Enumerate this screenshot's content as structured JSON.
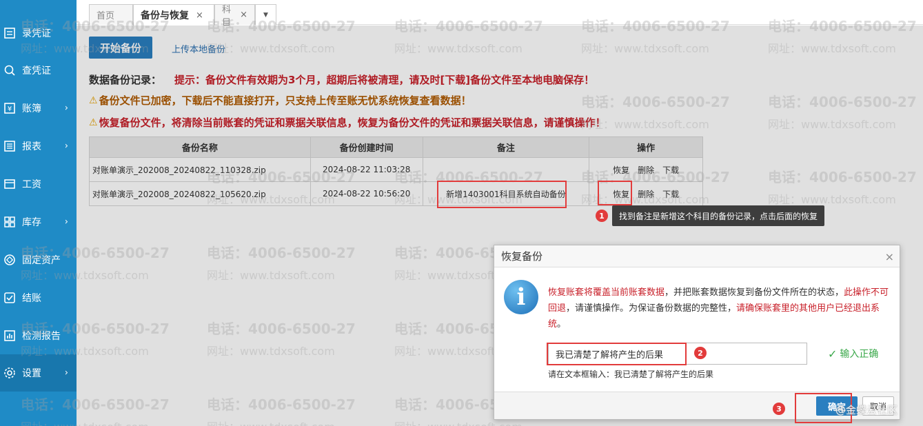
{
  "sidebar": {
    "items": [
      {
        "label": "录凭证",
        "icon": "voucher-icon"
      },
      {
        "label": "查凭证",
        "icon": "search-icon"
      },
      {
        "label": "账簿",
        "icon": "ledger-icon"
      },
      {
        "label": "报表",
        "icon": "report-icon"
      },
      {
        "label": "工资",
        "icon": "salary-icon"
      },
      {
        "label": "库存",
        "icon": "inventory-icon"
      },
      {
        "label": "固定资产",
        "icon": "asset-icon"
      },
      {
        "label": "结账",
        "icon": "checkout-icon"
      },
      {
        "label": "检测报告",
        "icon": "chart-icon"
      },
      {
        "label": "设置",
        "icon": "gear-icon"
      }
    ]
  },
  "tabs": {
    "home": "首页",
    "active": "备份与恢复",
    "subject": "科目",
    "close": "×"
  },
  "content": {
    "start_backup": "开始备份",
    "upload_local": "上传本地备份",
    "records_title": "数据备份记录：",
    "records_tip": "提示：备份文件有效期为3个月，超期后将被清理，请及时[下载]备份文件至本地电脑保存！",
    "warn1": "备份文件已加密，下载后不能直接打开，只支持上传至账无忧系统恢复查看数据！",
    "warn2": "恢复备份文件，将清除当前账套的凭证和票据关联信息，恢复为备份文件的凭证和票据关联信息，请谨慎操作！"
  },
  "table": {
    "headers": [
      "备份名称",
      "备份创建时间",
      "备注",
      "操作"
    ],
    "rows": [
      {
        "name": "对账单演示_202008_20240822_110328.zip",
        "time": "2024-08-22 11:03:28",
        "note": "",
        "restore": "恢复",
        "delete": "删除",
        "download": "下载"
      },
      {
        "name": "对账单演示_202008_20240822_105620.zip",
        "time": "2024-08-22 10:56:20",
        "note": "新增1403001科目系统自动备份",
        "restore": "恢复",
        "delete": "删除",
        "download": "下载"
      }
    ]
  },
  "annotation": {
    "step1": "1",
    "step2": "2",
    "step3": "3",
    "tooltip": "找到备注是新增这个科目的备份记录，点击后面的恢复"
  },
  "dialog": {
    "title": "恢复备份",
    "close": "×",
    "msg_red1": "恢复账套将覆盖当前账套数据",
    "msg_normal1": "，并把账套数据恢复到备份文件所在的状态，",
    "msg_red2": "此操作不可回退",
    "msg_normal2": "，请谨慎操作。为保证备份数据的完整性，",
    "msg_red3": "请确保账套里的其他用户已经退出系统",
    "msg_normal3": "。",
    "input_value": "我已清楚了解将产生的后果",
    "valid_text": "输入正确",
    "hint": "请在文本框输入：我已清楚了解将产生的后果",
    "ok": "确定",
    "cancel": "取消"
  },
  "watermark": {
    "phone": "电话：4006-6500-27",
    "site": "网址：www.tdxsoft.com"
  },
  "community": "@金蝶云社区",
  "colors": {
    "sidebar": "#1f8bc6",
    "primary": "#2a7fc0",
    "alert_red": "#c8202a",
    "highlight": "#e23b3b",
    "success": "#3aa84a"
  }
}
